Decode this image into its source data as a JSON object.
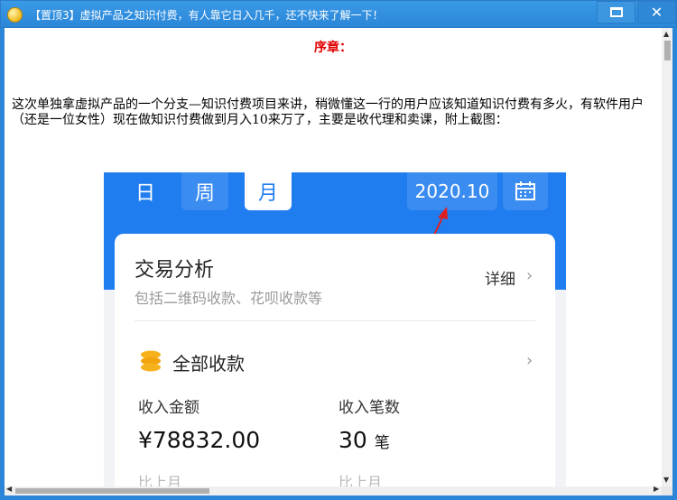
{
  "window": {
    "title": "【置顶3】虚拟产品之知识付费，有人靠它日入几千，还不快来了解一下！",
    "maximize_icon": "maximize-icon",
    "close_label": "✕"
  },
  "article": {
    "heading": "序章：",
    "paragraph": "这次单独拿虚拟产品的一个分支—知识付费项目来讲，稍微懂这一行的用户应该知道知识付费有多火，有软件用户（还是一位女性）现在做知识付费做到月入10来万了，主要是收代理和卖课，附上截图："
  },
  "screenshot": {
    "tabs": [
      "日",
      "周",
      "月"
    ],
    "date": "2020.10",
    "card_title": "交易分析",
    "card_subtitle": "包括二维码收款、花呗收款等",
    "detail_label": "详细",
    "chevron": "›",
    "all_label": "全部收款",
    "amount_label": "收入金额",
    "amount_value": "¥78832.00",
    "count_label": "收入笔数",
    "count_value": "30",
    "count_unit": "笔",
    "compare_label_1": "比上月",
    "compare_label_2": "比上月",
    "colors": {
      "brand_blue": "#1f7df0",
      "arrow_red": "#e02020"
    }
  }
}
